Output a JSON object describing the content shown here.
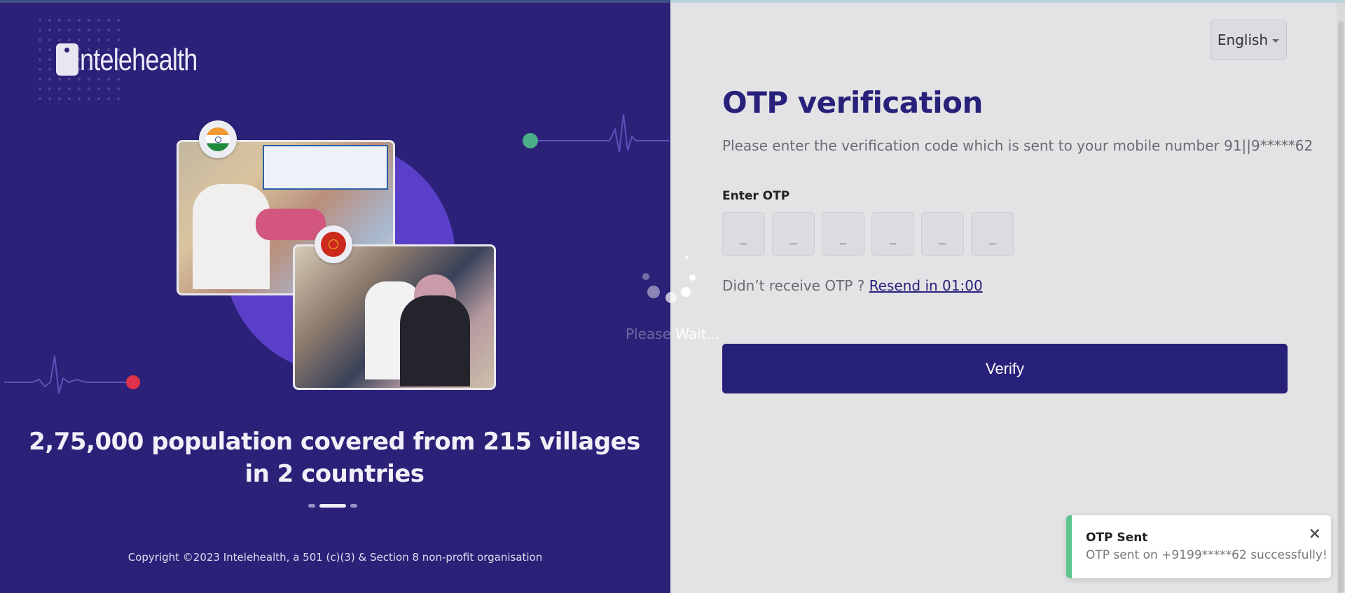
{
  "brand": {
    "logo_text": "ntelehealth"
  },
  "left": {
    "tagline": "2,75,000 population covered from 215 villages in 2 countries",
    "carousel": {
      "count": 3,
      "active_index": 1
    },
    "copyright": "Copyright ©2023 Intelehealth, a 501 (c)(3) & Section 8 non-profit organisation",
    "flags": [
      "india-flag-icon",
      "kyrgyzstan-flag-icon"
    ]
  },
  "loading": {
    "text_a": "Please ",
    "text_b": "Wait..."
  },
  "header": {
    "language": "English"
  },
  "otp": {
    "title": "OTP verification",
    "subtitle": "Please enter the verification code which is sent to your mobile number 91||9*****62",
    "label": "Enter OTP",
    "boxes": [
      "_",
      "_",
      "_",
      "_",
      "_",
      "_"
    ],
    "resend_prefix": "Didn’t receive OTP ? ",
    "resend_link": "Resend in 01:00",
    "verify_label": "Verify"
  },
  "toast": {
    "title": "OTP Sent",
    "message": "OTP sent on +9199*****62 successfully!",
    "close_icon": "×",
    "accent": "#5cc48c"
  },
  "colors": {
    "brand": "#28217a",
    "left_bg": "#2b2178",
    "accent_green": "#4fbf8a",
    "accent_red": "#e0324a"
  }
}
